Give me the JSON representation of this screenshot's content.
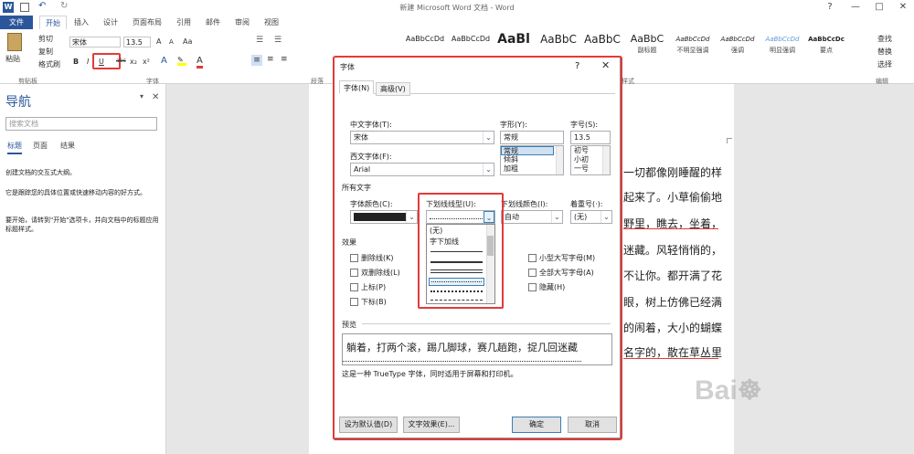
{
  "window": {
    "title": "新建 Microsoft Word 文档 - Word",
    "help": "?"
  },
  "ribbon_tabs": [
    "文件",
    "开始",
    "插入",
    "设计",
    "页面布局",
    "引用",
    "邮件",
    "审阅",
    "视图"
  ],
  "clipboard": {
    "paste": "粘贴",
    "cut": "剪切",
    "copy": "复制",
    "format_painter": "格式刷",
    "group": "剪贴板"
  },
  "font_group": {
    "font": "宋体",
    "size": "13.5",
    "label": "字体",
    "grow": "A",
    "shrink": "A",
    "clear": "Aa",
    "bold": "B",
    "italic": "I",
    "underline": "U",
    "strike": "abc",
    "sub": "x₂",
    "sup": "x²",
    "color_letter": "A"
  },
  "paragraph_group": {
    "label": "段落"
  },
  "styles": {
    "items": [
      {
        "sample": "AaBbCcDd",
        "name": ""
      },
      {
        "sample": "AaBbCcDd",
        "name": ""
      },
      {
        "sample": "AaBl",
        "name": ""
      },
      {
        "sample": "AaBbC",
        "name": ""
      },
      {
        "sample": "AaBbC",
        "name": ""
      },
      {
        "sample": "AaBbC",
        "name": "副标题"
      },
      {
        "sample": "AaBbCcDd",
        "name": "不明显强调"
      },
      {
        "sample": "AaBbCcDd",
        "name": "强调"
      },
      {
        "sample": "AaBbCcDd",
        "name": "明显强调"
      },
      {
        "sample": "AaBbCcDc",
        "name": "要点"
      }
    ],
    "group": "样式"
  },
  "editing": {
    "find": "查找",
    "replace": "替换",
    "select": "选择",
    "group": "编辑"
  },
  "nav": {
    "title": "导航",
    "search_placeholder": "搜索文档",
    "tabs": [
      "标题",
      "页面",
      "结果"
    ],
    "p1": "创建文档的交互式大纲。",
    "p2": "它是跟踪您的具体位置或快速移动内容的好方式。",
    "p3": "要开始，请转到\"开始\"选项卡，并向文档中的标题应用标题样式。"
  },
  "document_lines": [
    "一切都像刚睡醒的样",
    "起来了。小草偷偷地",
    "野里，瞧去，坐着，",
    "迷藏。风轻悄悄的，",
    "不让你。都开满了花",
    "眼，树上仿佛已经满",
    "的闹着，大小的蝴蝶",
    "名字的，散在草丛里"
  ],
  "dialog": {
    "title": "字体",
    "tabs": [
      "字体(N)",
      "高级(V)"
    ],
    "cn_font_label": "中文字体(T):",
    "cn_font": "宋体",
    "west_font_label": "西文字体(F):",
    "west_font": "Arial",
    "style_label": "字形(Y):",
    "style_value": "常规",
    "style_options": [
      "常规",
      "倾斜",
      "加粗"
    ],
    "size_label": "字号(S):",
    "size_value": "13.5",
    "size_options": [
      "初号",
      "小初",
      "一号"
    ],
    "all_text": "所有文字",
    "color_label": "字体颜色(C):",
    "underline_label": "下划线线型(U):",
    "underline_color_label": "下划线颜色(I):",
    "underline_color": "自动",
    "emphasis_label": "着重号(·):",
    "emphasis": "(无)",
    "underline_options": [
      "(无)",
      "字下加线"
    ],
    "effects": "效果",
    "effects_left": [
      "删除线(K)",
      "双删除线(L)",
      "上标(P)",
      "下标(B)"
    ],
    "effects_right": [
      "小型大写字母(M)",
      "全部大写字母(A)",
      "隐藏(H)"
    ],
    "preview_label": "预览",
    "preview_text": "躺着，打两个滚，踢几脚球，赛几趟跑，捉几回迷藏",
    "truetype_note": "这是一种 TrueType 字体，同时适用于屏幕和打印机。",
    "btn_default": "设为默认值(D)",
    "btn_effects": "文字效果(E)...",
    "btn_ok": "确定",
    "btn_cancel": "取消"
  },
  "colors": {
    "accent": "#2b579a",
    "highlight": "#e23a3a"
  }
}
